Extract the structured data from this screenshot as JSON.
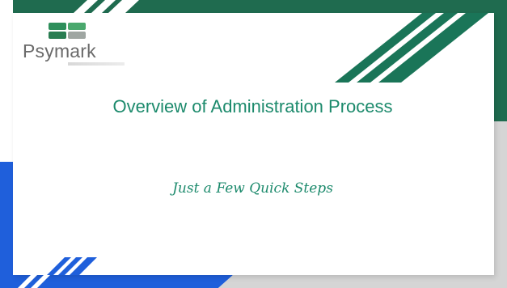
{
  "slide": {
    "logo": {
      "name": "Psymark"
    },
    "title": "Overview of Administration Process",
    "subtitle": "Just a Few Quick Steps"
  },
  "colors": {
    "green_dark": "#1f6b4f",
    "green_stripe": "#1a7558",
    "blue": "#1f5fdb",
    "gray": "#d5d5d5",
    "text_green": "#1c8a6c"
  },
  "icons": {
    "logo": "psymark-logo-icon"
  }
}
